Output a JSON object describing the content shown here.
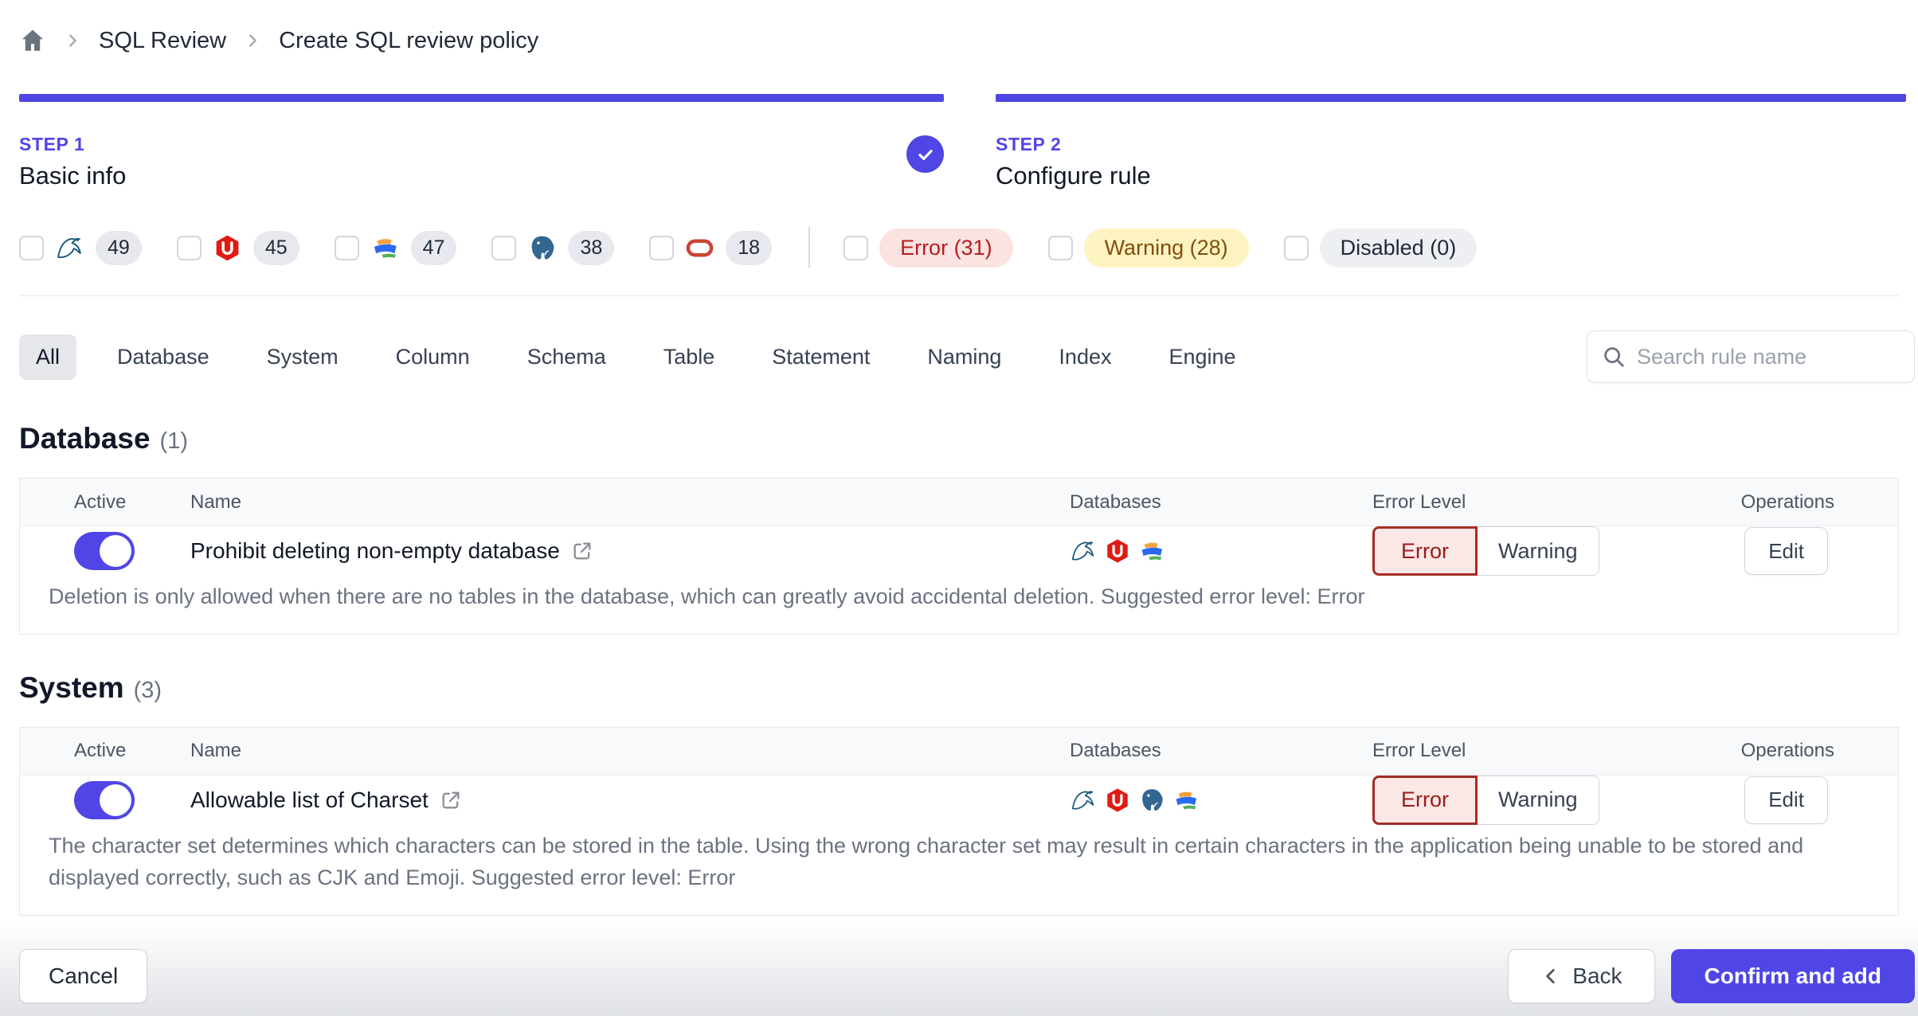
{
  "breadcrumb": {
    "items": [
      "SQL Review",
      "Create SQL review policy"
    ]
  },
  "steps": [
    {
      "label": "STEP 1",
      "title": "Basic info",
      "completed": true
    },
    {
      "label": "STEP 2",
      "title": "Configure rule",
      "completed": false
    }
  ],
  "filters": {
    "engines": [
      {
        "name": "mysql",
        "count": "49"
      },
      {
        "name": "tidb",
        "count": "45"
      },
      {
        "name": "oceanbase",
        "count": "47"
      },
      {
        "name": "postgres",
        "count": "38"
      },
      {
        "name": "oracle",
        "count": "18"
      }
    ],
    "levels": [
      {
        "type": "error",
        "label": "Error (31)"
      },
      {
        "type": "warning",
        "label": "Warning (28)"
      },
      {
        "type": "disabled",
        "label": "Disabled (0)"
      }
    ]
  },
  "tabs": [
    "All",
    "Database",
    "System",
    "Column",
    "Schema",
    "Table",
    "Statement",
    "Naming",
    "Index",
    "Engine"
  ],
  "search": {
    "placeholder": "Search rule name"
  },
  "sections": [
    {
      "title": "Database",
      "count": "(1)",
      "columns": [
        "Active",
        "Name",
        "Databases",
        "Error Level",
        "Operations"
      ],
      "rows": [
        {
          "active": true,
          "name": "Prohibit deleting non-empty database",
          "engines": [
            "mysql",
            "tidb",
            "oceanbase"
          ],
          "level": "Error",
          "description": "Deletion is only allowed when there are no tables in the database, which can greatly avoid accidental deletion. Suggested error level: Error"
        }
      ]
    },
    {
      "title": "System",
      "count": "(3)",
      "columns": [
        "Active",
        "Name",
        "Databases",
        "Error Level",
        "Operations"
      ],
      "rows": [
        {
          "active": true,
          "name": "Allowable list of Charset",
          "engines": [
            "mysql",
            "tidb",
            "postgres",
            "oceanbase"
          ],
          "level": "Error",
          "description": "The character set determines which characters can be stored in the table. Using the wrong character set may result in certain characters in the application being unable to be stored and displayed correctly, such as CJK and Emoji. Suggested error level: Error"
        }
      ]
    }
  ],
  "buttons": {
    "error": "Error",
    "warning": "Warning",
    "edit": "Edit",
    "cancel": "Cancel",
    "back": "Back",
    "confirm": "Confirm and add"
  },
  "icons": {
    "home": "home-icon",
    "breadcrumb_separator": "chevron-right-icon",
    "step_done": "check-icon",
    "search": "search-icon",
    "rule_link": "external-link-icon",
    "back": "chevron-left-icon",
    "engine_icons": [
      "mysql-icon",
      "tidb-icon",
      "oceanbase-icon",
      "postgres-icon",
      "oracle-icon"
    ]
  },
  "colors": {
    "accent": "#4f46e5",
    "error_text": "#b91c1c",
    "error_bg": "#fbe3e1",
    "warning_text": "#854d0e",
    "warning_bg": "#fdf3c0",
    "disabled_bg": "#edeff3",
    "table_header_bg": "#f8f9fb",
    "border": "#e5e7eb"
  }
}
